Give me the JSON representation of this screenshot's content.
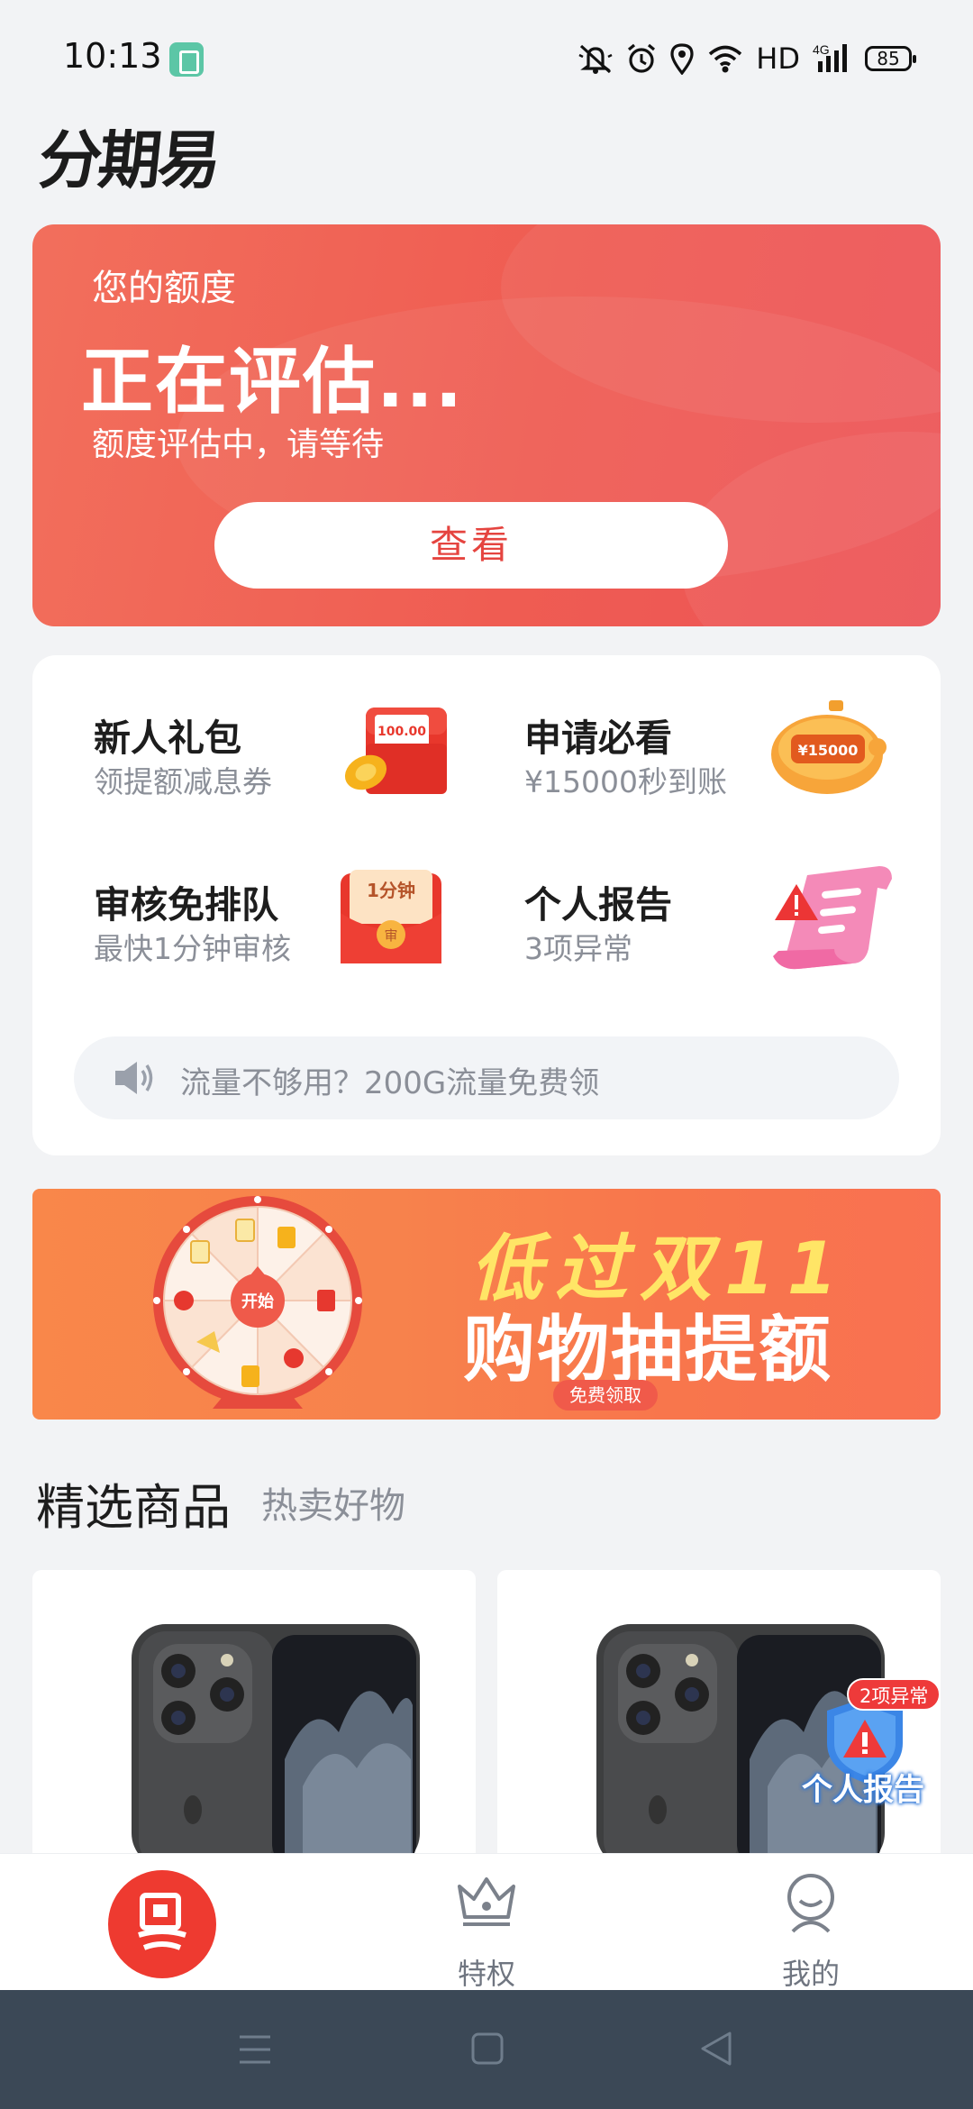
{
  "status_bar": {
    "time": "10:13",
    "network": "HD",
    "network_type": "4G",
    "battery": "85",
    "icons": [
      "app-notification-icon",
      "mute-icon",
      "alarm-icon",
      "location-icon",
      "wifi-icon",
      "signal-icon",
      "battery-icon"
    ]
  },
  "header": {
    "logo": "分期易"
  },
  "credit": {
    "label": "您的额度",
    "status": "正在评估...",
    "description": "额度评估中，请等待",
    "button": "查看",
    "colors": {
      "card": "#ef5c52",
      "button_text": "#e5443f"
    }
  },
  "quick_entries": [
    {
      "title": "新人礼包",
      "subtitle": "领提额减息券",
      "icon": "red-packet-gift-icon"
    },
    {
      "title": "申请必看",
      "subtitle": "¥15000秒到账",
      "icon": "piggy-bank-icon",
      "icon_text": "¥15000"
    },
    {
      "title": "审核免排队",
      "subtitle": "最快1分钟审核",
      "icon": "fast-review-envelope-icon",
      "icon_text": "1分钟",
      "icon_seal": "审"
    },
    {
      "title": "个人报告",
      "subtitle": "3项异常",
      "icon": "report-warning-icon"
    }
  ],
  "notice": {
    "text": "流量不够用？200G流量免费领",
    "icon": "speaker-icon"
  },
  "banner": {
    "wheel_center": "开始",
    "line1": "低过双11",
    "line2": "购物抽提额",
    "tag": "免费领取"
  },
  "section": {
    "title": "精选商品",
    "subtitle": "热卖好物"
  },
  "products": [
    {
      "image": "phone-image"
    },
    {
      "image": "phone-image"
    }
  ],
  "floating_report": {
    "badge": "2项异常",
    "label": "个人报告"
  },
  "tab_bar": {
    "items": [
      {
        "label": "",
        "icon": "home-logo-icon",
        "active": true
      },
      {
        "label": "特权",
        "icon": "crown-icon",
        "active": false
      },
      {
        "label": "我的",
        "icon": "profile-icon",
        "active": false
      }
    ]
  },
  "system_nav": {
    "icons": [
      "menu-icon",
      "home-square-icon",
      "back-triangle-icon"
    ]
  }
}
